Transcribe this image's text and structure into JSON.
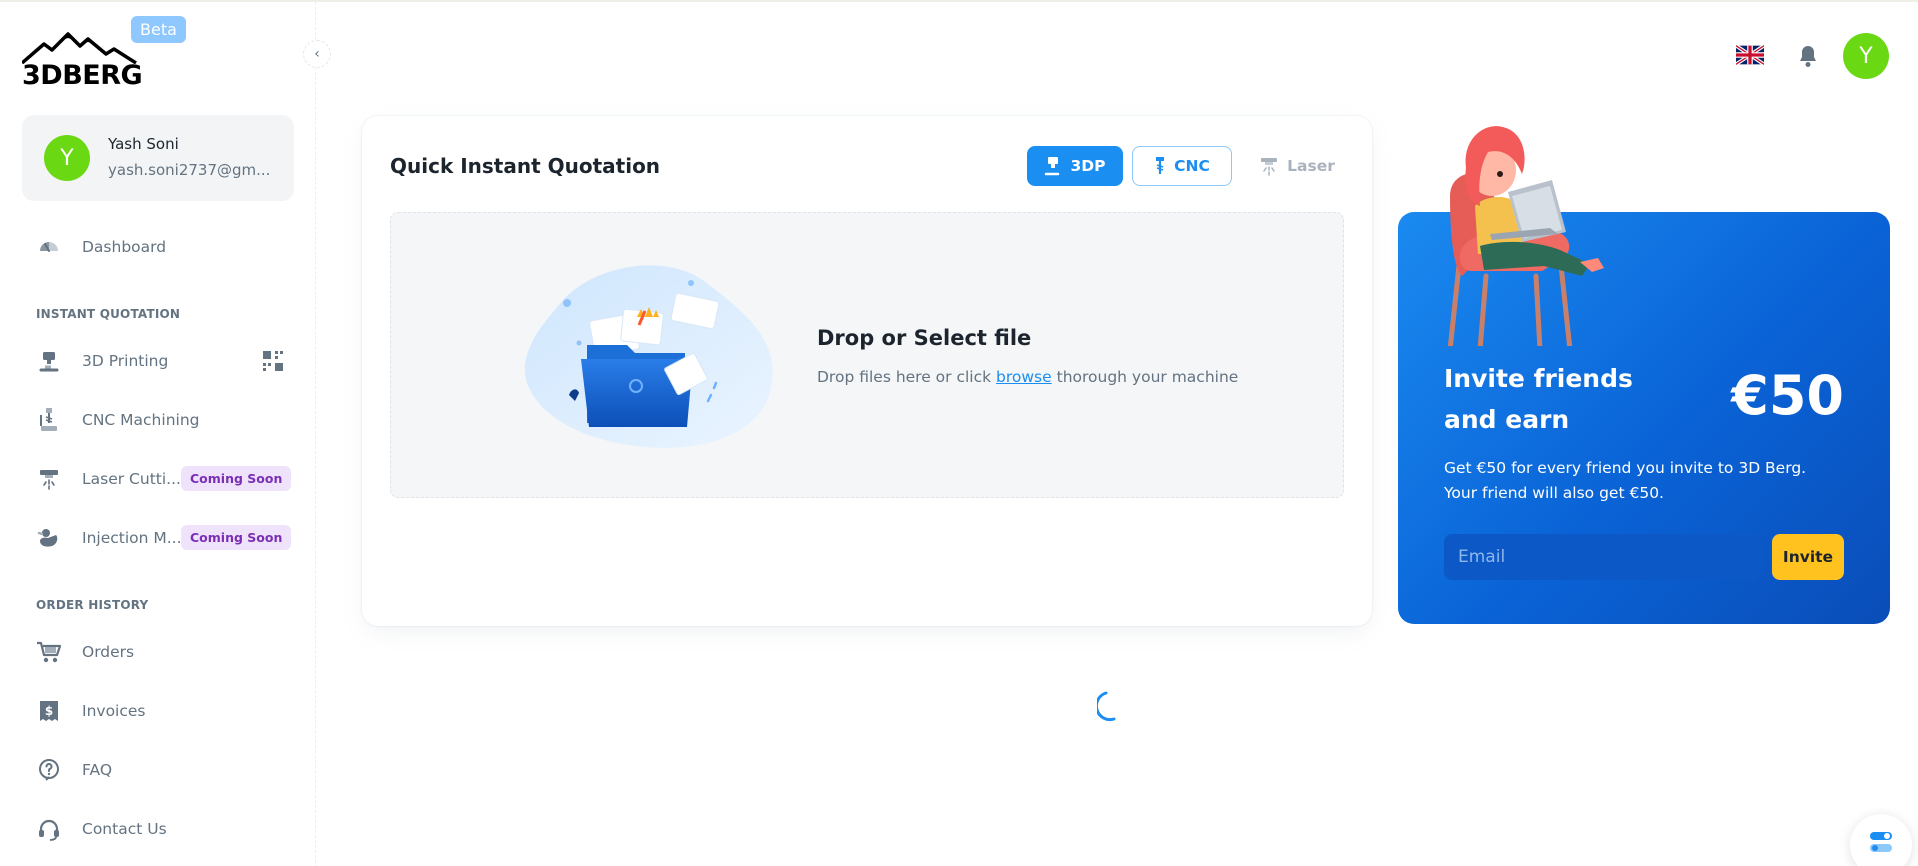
{
  "brand": {
    "logo_text": "3DBERG",
    "beta_label": "Beta"
  },
  "user": {
    "initial": "Y",
    "name": "Yash Soni",
    "email": "yash.soni2737@gm..."
  },
  "sidebar": {
    "dashboard": "Dashboard",
    "section_instant": "INSTANT QUOTATION",
    "items_instant": [
      {
        "label": "3D Printing"
      },
      {
        "label": "CNC Machining"
      },
      {
        "label": "Laser Cutti...",
        "badge": "Coming Soon"
      },
      {
        "label": "Injection M...",
        "badge": "Coming Soon"
      }
    ],
    "section_history": "ORDER HISTORY",
    "items_history": [
      {
        "label": "Orders"
      },
      {
        "label": "Invoices"
      },
      {
        "label": "FAQ"
      },
      {
        "label": "Contact Us"
      }
    ]
  },
  "topbar": {
    "avatar_initial": "Y"
  },
  "quotation": {
    "title": "Quick Instant Quotation",
    "tabs": [
      "3DP",
      "CNC",
      "Laser"
    ],
    "active_tab": "3DP",
    "drop_title": "Drop or Select file",
    "drop_sub_before": "Drop files here or click ",
    "drop_link": "browse",
    "drop_sub_after": " thorough your machine"
  },
  "invite": {
    "title": "Invite friends and earn",
    "amount": "€50",
    "description": "Get €50 for every friend you invite to 3D Berg. Your friend will also get €50.",
    "email_placeholder": "Email",
    "button_label": "Invite"
  },
  "colors": {
    "primary": "#1b8ef2",
    "avatar": "#6bd814",
    "badge_bg": "#efe3fb",
    "badge_text": "#7a2fb5",
    "invite_button": "#ffc21f"
  }
}
